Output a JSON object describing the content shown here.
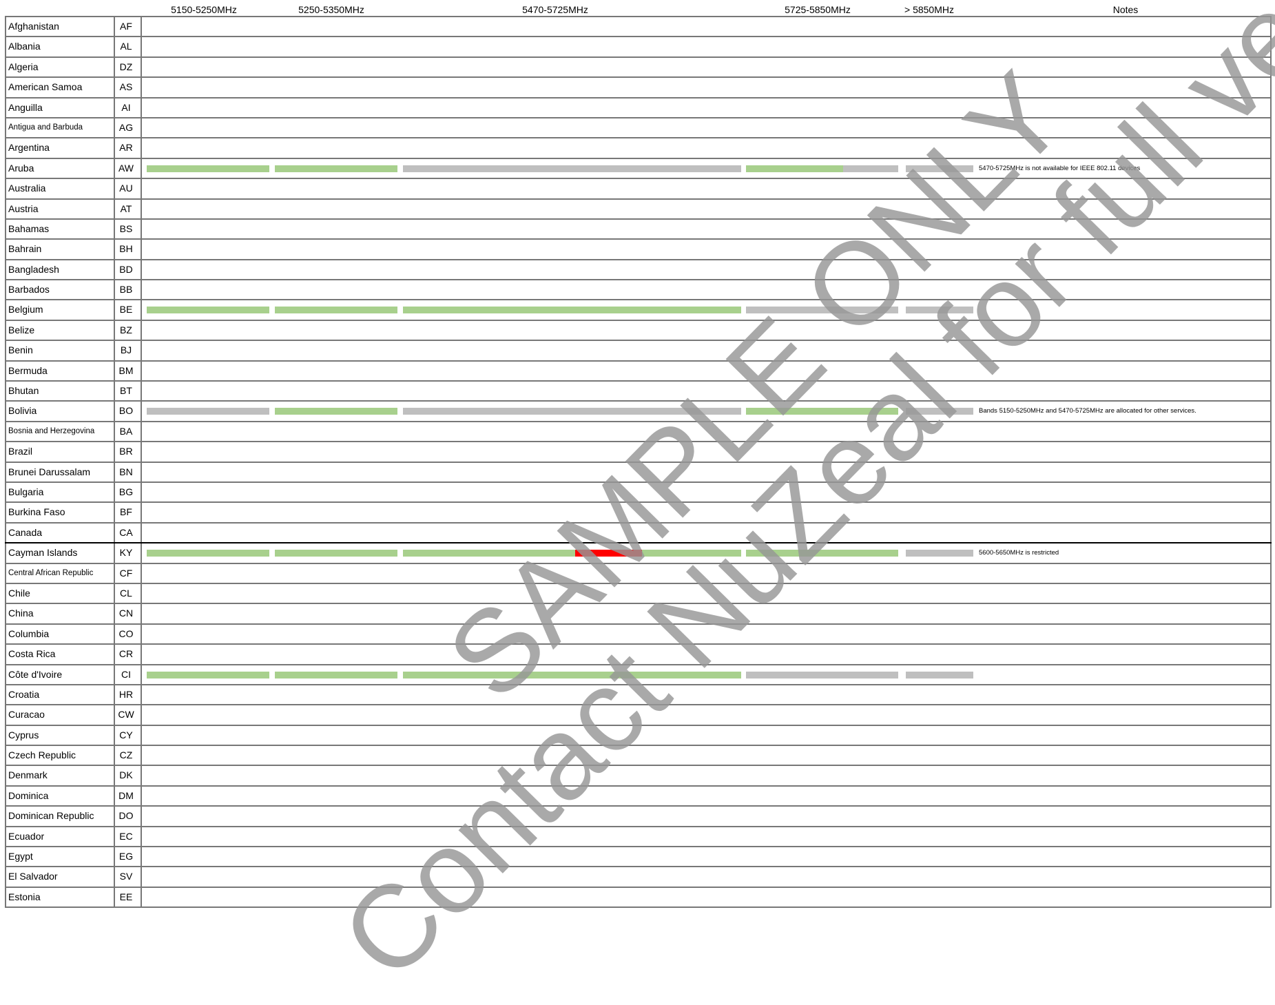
{
  "header": {
    "columns": [
      "5150-5250MHz",
      "5250-5350MHz",
      "5470-5725MHz",
      "5725-5850MHz",
      "> 5850MHz",
      "Notes"
    ]
  },
  "colors": {
    "allowed": "#a8d08d",
    "other": "#bfbfbf",
    "restricted": "#ff0000",
    "grid": "#777777"
  },
  "rows": [
    {
      "name": "Afghanistan",
      "code": "AF"
    },
    {
      "name": "Albania",
      "code": "AL"
    },
    {
      "name": "Algeria",
      "code": "DZ"
    },
    {
      "name": "American Samoa",
      "code": "AS"
    },
    {
      "name": "Anguilla",
      "code": "AI"
    },
    {
      "name": "Antigua and Barbuda",
      "code": "AG",
      "small": true
    },
    {
      "name": "Argentina",
      "code": "AR"
    },
    {
      "name": "Aruba",
      "code": "AW",
      "note": "5470-5725MHz is not available for IEEE 802.11 devices",
      "segments": [
        {
          "from": 5150,
          "to": 5250,
          "color": "allowed"
        },
        {
          "from": 5250,
          "to": 5350,
          "color": "allowed"
        },
        {
          "from": 5470,
          "to": 5725,
          "color": "other"
        },
        {
          "from": 5725,
          "to": 5805,
          "color": "allowed"
        },
        {
          "from": 5805,
          "to": 5850,
          "color": "other"
        },
        {
          "from": 5850,
          "to": 5925,
          "color": "other"
        }
      ]
    },
    {
      "name": "Australia",
      "code": "AU"
    },
    {
      "name": "Austria",
      "code": "AT"
    },
    {
      "name": "Bahamas",
      "code": "BS"
    },
    {
      "name": "Bahrain",
      "code": "BH"
    },
    {
      "name": "Bangladesh",
      "code": "BD"
    },
    {
      "name": "Barbados",
      "code": "BB"
    },
    {
      "name": "Belgium",
      "code": "BE",
      "segments": [
        {
          "from": 5150,
          "to": 5250,
          "color": "allowed"
        },
        {
          "from": 5250,
          "to": 5350,
          "color": "allowed"
        },
        {
          "from": 5470,
          "to": 5725,
          "color": "allowed"
        },
        {
          "from": 5725,
          "to": 5850,
          "color": "other"
        },
        {
          "from": 5850,
          "to": 5925,
          "color": "other"
        }
      ]
    },
    {
      "name": "Belize",
      "code": "BZ"
    },
    {
      "name": "Benin",
      "code": "BJ"
    },
    {
      "name": "Bermuda",
      "code": "BM"
    },
    {
      "name": "Bhutan",
      "code": "BT"
    },
    {
      "name": "Bolivia",
      "code": "BO",
      "note": "Bands 5150-5250MHz and 5470-5725MHz are allocated for other services.",
      "segments": [
        {
          "from": 5150,
          "to": 5250,
          "color": "other"
        },
        {
          "from": 5250,
          "to": 5350,
          "color": "allowed"
        },
        {
          "from": 5470,
          "to": 5725,
          "color": "other"
        },
        {
          "from": 5725,
          "to": 5850,
          "color": "allowed"
        },
        {
          "from": 5850,
          "to": 5925,
          "color": "other"
        }
      ]
    },
    {
      "name": "Bosnia and Herzegovina",
      "code": "BA",
      "small": true
    },
    {
      "name": "Brazil",
      "code": "BR"
    },
    {
      "name": "Brunei Darussalam",
      "code": "BN"
    },
    {
      "name": "Bulgaria",
      "code": "BG"
    },
    {
      "name": "Burkina Faso",
      "code": "BF"
    },
    {
      "name": "Canada",
      "code": "CA",
      "thick": true
    },
    {
      "name": "Cayman Islands",
      "code": "KY",
      "note": "5600-5650MHz is restricted",
      "segments": [
        {
          "from": 5150,
          "to": 5250,
          "color": "allowed"
        },
        {
          "from": 5250,
          "to": 5350,
          "color": "allowed"
        },
        {
          "from": 5470,
          "to": 5600,
          "color": "allowed"
        },
        {
          "from": 5600,
          "to": 5650,
          "color": "restricted"
        },
        {
          "from": 5650,
          "to": 5725,
          "color": "allowed"
        },
        {
          "from": 5725,
          "to": 5850,
          "color": "allowed"
        },
        {
          "from": 5850,
          "to": 5925,
          "color": "other"
        }
      ]
    },
    {
      "name": "Central African Republic",
      "code": "CF",
      "small": true
    },
    {
      "name": "Chile",
      "code": "CL"
    },
    {
      "name": "China",
      "code": "CN"
    },
    {
      "name": "Columbia",
      "code": "CO"
    },
    {
      "name": "Costa Rica",
      "code": "CR"
    },
    {
      "name": "Côte d'Ivoire",
      "code": "CI",
      "segments": [
        {
          "from": 5150,
          "to": 5250,
          "color": "allowed"
        },
        {
          "from": 5250,
          "to": 5350,
          "color": "allowed"
        },
        {
          "from": 5470,
          "to": 5725,
          "color": "allowed"
        },
        {
          "from": 5725,
          "to": 5850,
          "color": "other"
        },
        {
          "from": 5850,
          "to": 5925,
          "color": "other"
        }
      ]
    },
    {
      "name": "Croatia",
      "code": "HR"
    },
    {
      "name": "Curacao",
      "code": "CW"
    },
    {
      "name": "Cyprus",
      "code": "CY"
    },
    {
      "name": "Czech Republic",
      "code": "CZ"
    },
    {
      "name": "Denmark",
      "code": "DK"
    },
    {
      "name": "Dominica",
      "code": "DM"
    },
    {
      "name": "Dominican Republic",
      "code": "DO"
    },
    {
      "name": "Ecuador",
      "code": "EC"
    },
    {
      "name": "Egypt",
      "code": "EG"
    },
    {
      "name": "El Salvador",
      "code": "SV"
    },
    {
      "name": "Estonia",
      "code": "EE"
    }
  ],
  "watermark": {
    "line1": "SAMPLE ONLY",
    "line2": "Contact NuZeal for full verison"
  }
}
